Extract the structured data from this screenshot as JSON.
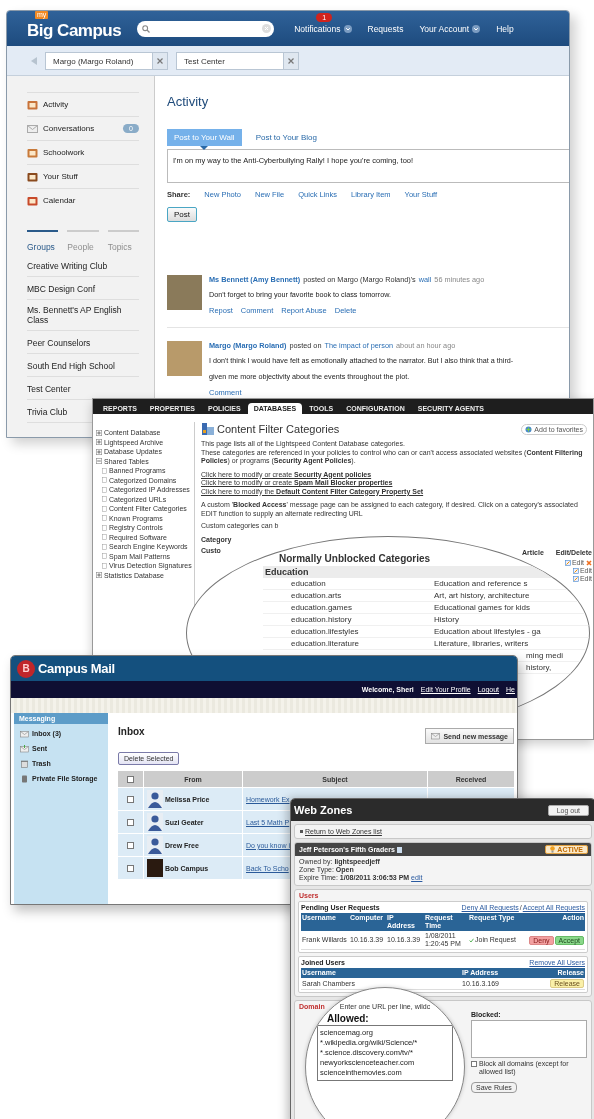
{
  "big_campus": {
    "logo_badge": "my",
    "logo": "Big Campus",
    "nav": [
      {
        "label": "Notifications",
        "badge": "1",
        "dropdown": true
      },
      {
        "label": "Requests",
        "dropdown": false
      },
      {
        "label": "Your Account",
        "dropdown": true
      },
      {
        "label": "Help",
        "dropdown": false
      }
    ],
    "open_tabs": [
      "Margo (Margo Roland)",
      "Test Center"
    ],
    "sidebar": {
      "items": [
        {
          "label": "Activity"
        },
        {
          "label": "Conversations",
          "count": "0"
        },
        {
          "label": "Schoolwork"
        },
        {
          "label": "Your Stuff"
        },
        {
          "label": "Calendar"
        }
      ],
      "group_tabs": [
        {
          "label": "Groups",
          "selected": true
        },
        {
          "label": "People",
          "selected": false
        },
        {
          "label": "Topics",
          "selected": false
        }
      ],
      "groups": [
        "Creative Writing Club",
        "MBC Design Conf",
        "Ms. Bennett's AP English Class",
        "Peer Counselors",
        "South End High School",
        "Test Center",
        "Trivia Club"
      ]
    },
    "main": {
      "title": "Activity",
      "post_tabs": [
        {
          "label": "Post to Your Wall",
          "selected": true
        },
        {
          "label": "Post to Your Blog",
          "selected": false
        }
      ],
      "post_text": "I'm on my way to the Anti-Cyberbullying Rally! I hope you're coming, too!",
      "share_label": "Share:",
      "share_links": [
        "New Photo",
        "New File",
        "Quick Links",
        "Library Item",
        "Your Stuff"
      ],
      "post_button": "Post",
      "posts": [
        {
          "author": "Ms Bennett (Amy Bennett)",
          "action": "posted on Margo (Margo Roland)'s",
          "target": "wall",
          "time": "56 minutes ago",
          "lines": [
            "Don't forget to bring your favorite book to class tomorrow."
          ],
          "actions": [
            "Repost",
            "Comment",
            "Report Abuse",
            "Delete"
          ]
        },
        {
          "author": "Margo (Margo Roland)",
          "action": "posted on",
          "target": "The impact of person",
          "time": "about an hour ago",
          "lines": [
            "I don't think I would have felt as emotionally attached to the narrator. But I also think that a third-",
            "given me more objectivity about the events throughout the plot."
          ],
          "actions": [
            "Comment"
          ]
        }
      ]
    }
  },
  "lightspeed": {
    "tabs": [
      {
        "label": "REPORTS",
        "selected": false
      },
      {
        "label": "PROPERTIES",
        "selected": false
      },
      {
        "label": "POLICIES",
        "selected": false
      },
      {
        "label": "DATABASES",
        "selected": true
      },
      {
        "label": "TOOLS",
        "selected": false
      },
      {
        "label": "CONFIGURATION",
        "selected": false
      },
      {
        "label": "SECURITY AGENTS",
        "selected": false
      }
    ],
    "tree": [
      {
        "label": "Content Database",
        "expanded": false
      },
      {
        "label": "Lightspeed Archive",
        "expanded": false
      },
      {
        "label": "Database Updates",
        "expanded": false
      },
      {
        "label": "Shared Tables",
        "expanded": true,
        "children": [
          {
            "label": "Banned Programs"
          },
          {
            "label": "Categorized Domains"
          },
          {
            "label": "Categorized IP Addresses"
          },
          {
            "label": "Categorized URLs"
          },
          {
            "label": "Content Filter Categories"
          },
          {
            "label": "Known Programs"
          },
          {
            "label": "Registry Controls"
          },
          {
            "label": "Required Software"
          },
          {
            "label": "Search Engine Keywords"
          },
          {
            "label": "Spam Mail Patterns"
          },
          {
            "label": "Virus Detection Signatures"
          }
        ]
      },
      {
        "label": "Statistics Database",
        "expanded": false
      }
    ],
    "title": "Content Filter Categories",
    "favorites": "Add to favorites",
    "intro": [
      "This page lists all of the Lightspeed Content Database categories.",
      "These categories are referenced in your policies to control who can or can't access associated websites (**Content Filtering Policies**) or programs (**Security Agent Policies**)."
    ],
    "links": [
      "Click here to modify or create **Security Agent policies**",
      "Click here to modify or create **Spam Mail Blocker properties**",
      "Click here to modify the **Default Content Filter Category Property Set**"
    ],
    "note": "A custom '**Blocked Access**' message page can be assigned to each category, if desired. Click on a category's associated EDIT function to supply an alternate redirecting URL",
    "custom_note": "Custom categories can b",
    "table": {
      "columns": [
        "Category",
        "Article",
        "Edit/Delete"
      ],
      "first_cell": "Custo",
      "edit_links": [
        "Edit",
        "Edit",
        "Edit"
      ]
    },
    "zoom": {
      "title": "Normally Unblocked Categories",
      "group": "Education",
      "rows": [
        {
          "kind": "full",
          "name": "education",
          "description": "Education and reference s"
        },
        {
          "kind": "full",
          "name": "education.arts",
          "description": "Art, art history, architecture"
        },
        {
          "kind": "full",
          "name": "education.games",
          "description": "Educational games for kids"
        },
        {
          "kind": "full",
          "name": "education.history",
          "description": "History"
        },
        {
          "kind": "full",
          "name": "education.lifestyles",
          "description": "Education about lifestyles - ga"
        },
        {
          "kind": "full",
          "name": "education.literature",
          "description": "Literature, libraries, writers"
        },
        {
          "kind": "cut",
          "description": "ming medi"
        },
        {
          "kind": "cut",
          "description": "history,"
        }
      ]
    }
  },
  "campus_mail": {
    "logo_mark": "B",
    "logo": "Campus Mail",
    "welcome": "Welcome, Sheri",
    "links": [
      "Edit Your Profile",
      "Logout",
      "He"
    ],
    "sidebar": {
      "title": "Messaging",
      "items": [
        "Inbox (3)",
        "Sent",
        "Trash",
        "Private File Storage"
      ]
    },
    "title": "Inbox",
    "send_button": "Send new message",
    "delete_button": "Delete Selected",
    "table": {
      "header_checked": false,
      "columns": [
        "From",
        "Subject",
        "Received"
      ],
      "rows": [
        {
          "from": "Melissa Price",
          "subject": "Homework Ex",
          "checked": false,
          "kind": "silhouette"
        },
        {
          "from": "Suzi Geater",
          "subject": "Last 5 Math P",
          "checked": false,
          "kind": "silhouette"
        },
        {
          "from": "Drew Free",
          "subject": "Do you know i",
          "checked": false,
          "kind": "silhouette"
        },
        {
          "from": "Bob Campus",
          "subject": "Back To Scho",
          "checked": false,
          "kind": "picture"
        }
      ]
    }
  },
  "web_zones": {
    "title": "Web Zones",
    "logout": "Log out",
    "back_link": "Return to Web Zones list",
    "zone": {
      "name": "Jeff Peterson's Fifth Graders",
      "status": "ACTIVE",
      "details": [
        {
          "label": "Owned by:",
          "value": "lightspeedjeff"
        },
        {
          "label": "Zone Type:",
          "value": "Open"
        },
        {
          "label": "Expire Time:",
          "value": "1/08/2011 3:06:53 PM"
        }
      ],
      "edit_link": "edit"
    },
    "users": {
      "title": "Users",
      "pending": {
        "title": "Pending User Requests",
        "links": [
          "Deny All Requests",
          "Accept All Requests"
        ],
        "separator": "/",
        "columns": [
          "Username",
          "Computer",
          "IP Address",
          "Request Time",
          "Request Type",
          "Action"
        ],
        "rows": [
          {
            "username": "Frank Willards",
            "computer": "10.16.3.39",
            "ip": "10.16.3.39",
            "time": "1/08/2011 1:20:45 PM",
            "type": "Join Request",
            "deny": "Deny",
            "accept": "Accept"
          }
        ]
      },
      "joined": {
        "title": "Joined Users",
        "link": "Remove All Users",
        "columns": [
          "Username",
          "IP Address",
          "Release"
        ],
        "rows": [
          {
            "username": "Sarah Chambers",
            "ip": "10.16.3.169",
            "release": "Release"
          }
        ]
      }
    },
    "domains": {
      "title": "Domain",
      "blocked_label": "Blocked:",
      "block_all": "Block all domains (except for allowed list)",
      "block_all_checked": false,
      "save": "Save Rules"
    },
    "zoom": {
      "hint": "Enter one URL per line, wildc",
      "allowed_label": "Allowed:",
      "allowed": [
        "sciencemag.org",
        "*.wikipedia.org/wiki/Science/*",
        "*.science.discovery.com/tv/*",
        "newyorkscienceteacher.com",
        "scienceinthemovies.com"
      ]
    }
  }
}
